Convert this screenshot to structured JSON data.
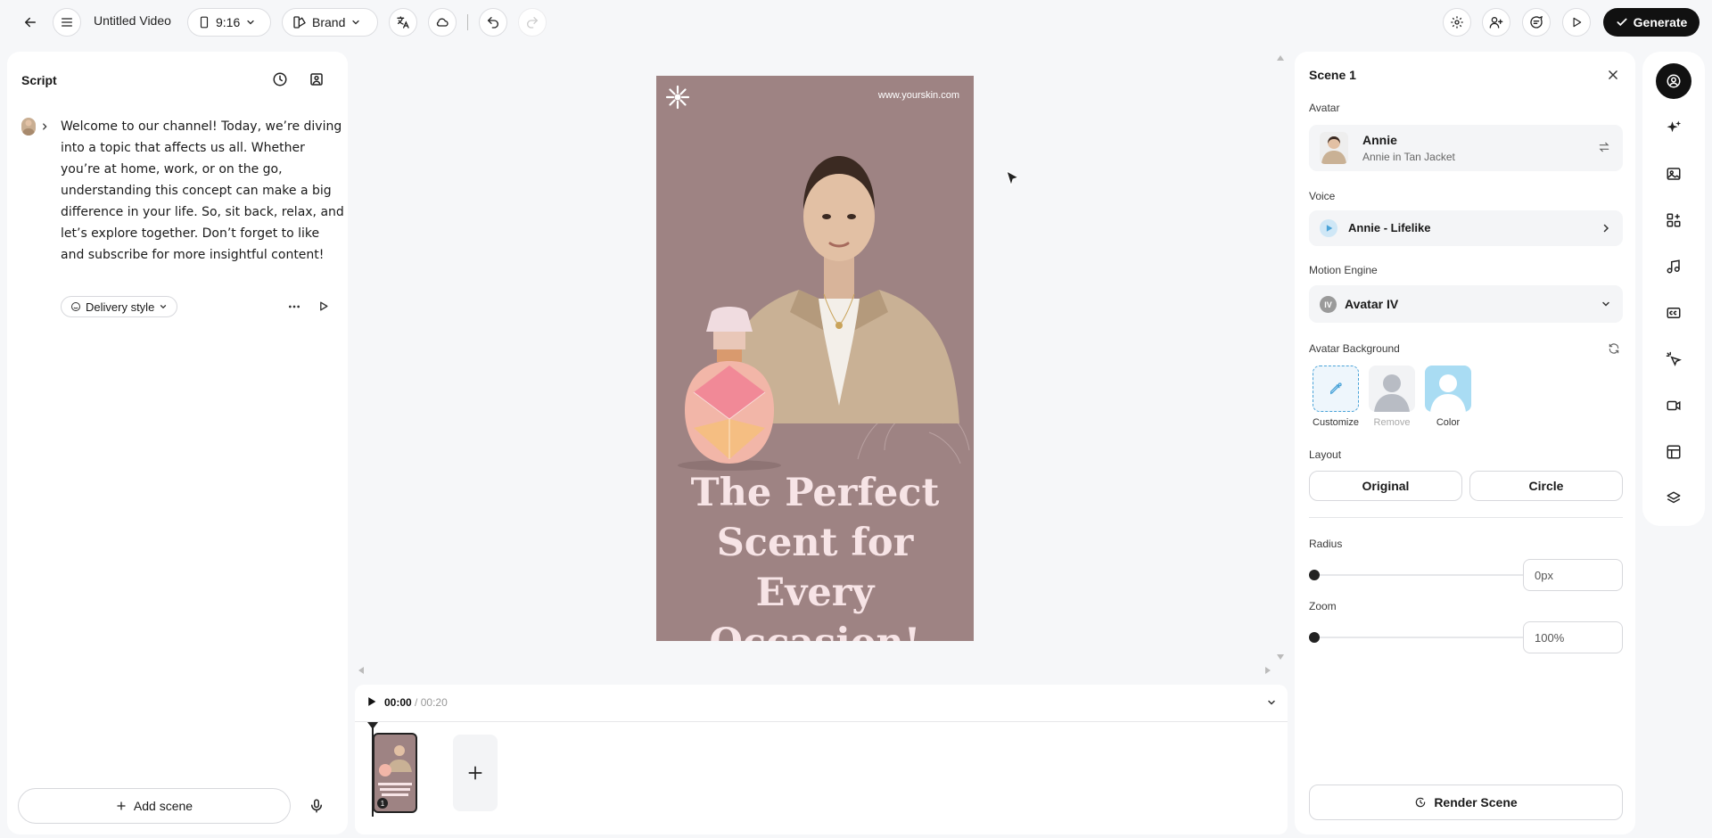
{
  "header": {
    "title": "Untitled Video",
    "aspect_ratio": "9:16",
    "brand_label": "Brand",
    "generate_label": "Generate"
  },
  "script": {
    "title": "Script",
    "text": "Welcome to our channel! Today, we’re diving into a topic that affects us all. Whether you’re at home, work, or on the go, understanding this concept can make a big difference in your life. So, sit back, relax, and let’s explore together. Don’t forget to like and subscribe for more insightful content!",
    "delivery_style_label": "Delivery style",
    "add_scene_label": "Add scene"
  },
  "canvas": {
    "url_text": "www.yourskin.com",
    "headline_lines": [
      "The Perfect",
      "Scent for Every",
      "Occasion!"
    ],
    "background_color": "#9e8383",
    "headline_color": "#f7e4e6"
  },
  "timeline": {
    "current_time": "00:00",
    "separator": " / ",
    "total_time": "00:20",
    "scene_number": "1"
  },
  "scene_panel": {
    "title": "Scene 1",
    "avatar_label": "Avatar",
    "avatar_name": "Annie",
    "avatar_look": "Annie in Tan Jacket",
    "voice_label": "Voice",
    "voice_name": "Annie - Lifelike",
    "motion_engine_label": "Motion Engine",
    "motion_engine_badge": "IV",
    "motion_engine_value": "Avatar IV",
    "background_label": "Avatar Background",
    "bg_options": [
      "Customize",
      "Remove",
      "Color"
    ],
    "layout_label": "Layout",
    "layout_options": [
      "Original",
      "Circle"
    ],
    "radius_label": "Radius",
    "radius_value": "0px",
    "zoom_label": "Zoom",
    "zoom_value": "100%",
    "render_label": "Render Scene"
  },
  "colors": {
    "accent_blue": "#4aa3d8",
    "generate_bg": "#111111"
  }
}
